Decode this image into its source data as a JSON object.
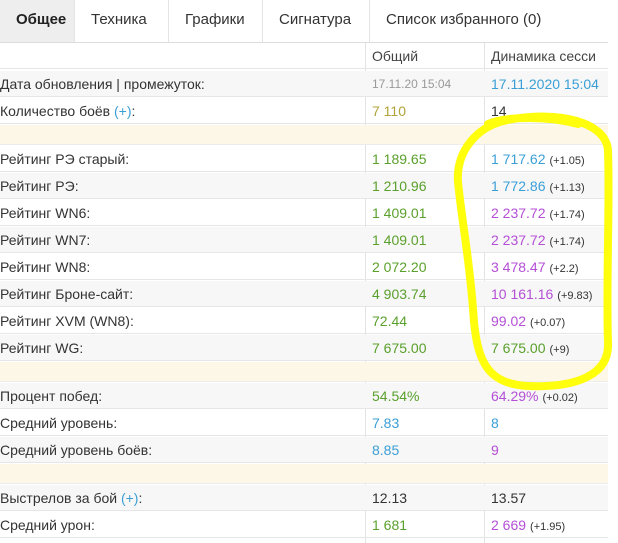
{
  "tabs": [
    {
      "label": "Общее",
      "active": true
    },
    {
      "label": "Техника"
    },
    {
      "label": "Графики"
    },
    {
      "label": "Сигнатура"
    },
    {
      "label": "Список избранного (0)"
    }
  ],
  "columns": {
    "total": "Общий",
    "dynamic": "Динамика сесси"
  },
  "colors": {
    "olive": "#b0a33a",
    "green": "#5aa02c",
    "blue": "#3a9fd6",
    "purple": "#b44fd6",
    "dark": "#333333",
    "grey": "#999999",
    "marker": "#ffff00"
  },
  "rows": [
    {
      "label": "Дата обновления | промежуток:",
      "total": "17.11.20 15:04",
      "total_color": "grey",
      "dyn": "17.11.2020 15:04",
      "dyn_color": "blue",
      "small_total": true
    },
    {
      "label": "Количество боёв ",
      "plus": "(+)",
      "label_tail": ":",
      "total": "7 110",
      "total_color": "olive",
      "dyn": "14",
      "dyn_color": "dark"
    },
    {
      "separator": true
    },
    {
      "label": "Рейтинг РЭ старый:",
      "total": "1 189.65",
      "total_color": "green",
      "dyn": "1 717.62",
      "dyn_color": "blue",
      "delta": "(+1.05)"
    },
    {
      "label": "Рейтинг РЭ:",
      "total": "1 210.96",
      "total_color": "green",
      "dyn": "1 772.86",
      "dyn_color": "blue",
      "delta": "(+1.13)"
    },
    {
      "label": "Рейтинг WN6:",
      "total": "1 409.01",
      "total_color": "green",
      "dyn": "2 237.72",
      "dyn_color": "purple",
      "delta": "(+1.74)"
    },
    {
      "label": "Рейтинг WN7:",
      "total": "1 409.01",
      "total_color": "green",
      "dyn": "2 237.72",
      "dyn_color": "purple",
      "delta": "(+1.74)"
    },
    {
      "label": "Рейтинг WN8:",
      "total": "2 072.20",
      "total_color": "green",
      "dyn": "3 478.47",
      "dyn_color": "purple",
      "delta": "(+2.2)"
    },
    {
      "label": "Рейтинг Броне-сайт:",
      "total": "4 903.74",
      "total_color": "green",
      "dyn": "10 161.16",
      "dyn_color": "purple",
      "delta": "(+9.83)"
    },
    {
      "label": "Рейтинг XVM (WN8):",
      "total": "72.44",
      "total_color": "green",
      "dyn": "99.02",
      "dyn_color": "purple",
      "delta": "(+0.07)"
    },
    {
      "label": "Рейтинг WG:",
      "total": "7 675.00",
      "total_color": "green",
      "dyn": "7 675.00",
      "dyn_color": "green",
      "delta": "(+9)"
    },
    {
      "separator": true
    },
    {
      "label": "Процент побед:",
      "total": "54.54%",
      "total_color": "green",
      "dyn": "64.29%",
      "dyn_color": "purple",
      "delta": "(+0.02)"
    },
    {
      "label": "Средний уровень:",
      "total": "7.83",
      "total_color": "blue",
      "dyn": "8",
      "dyn_color": "blue"
    },
    {
      "label": "Средний уровень боёв:",
      "total": "8.85",
      "total_color": "blue",
      "dyn": "9",
      "dyn_color": "purple"
    },
    {
      "separator": true
    },
    {
      "label": "Выстрелов за бой ",
      "plus": "(+)",
      "label_tail": ":",
      "total": "12.13",
      "total_color": "dark",
      "dyn": "13.57",
      "dyn_color": "dark"
    },
    {
      "label": "Средний урон:",
      "total": "1 681",
      "total_color": "green",
      "dyn": "2 669",
      "dyn_color": "purple",
      "delta": "(+1.95)"
    }
  ]
}
